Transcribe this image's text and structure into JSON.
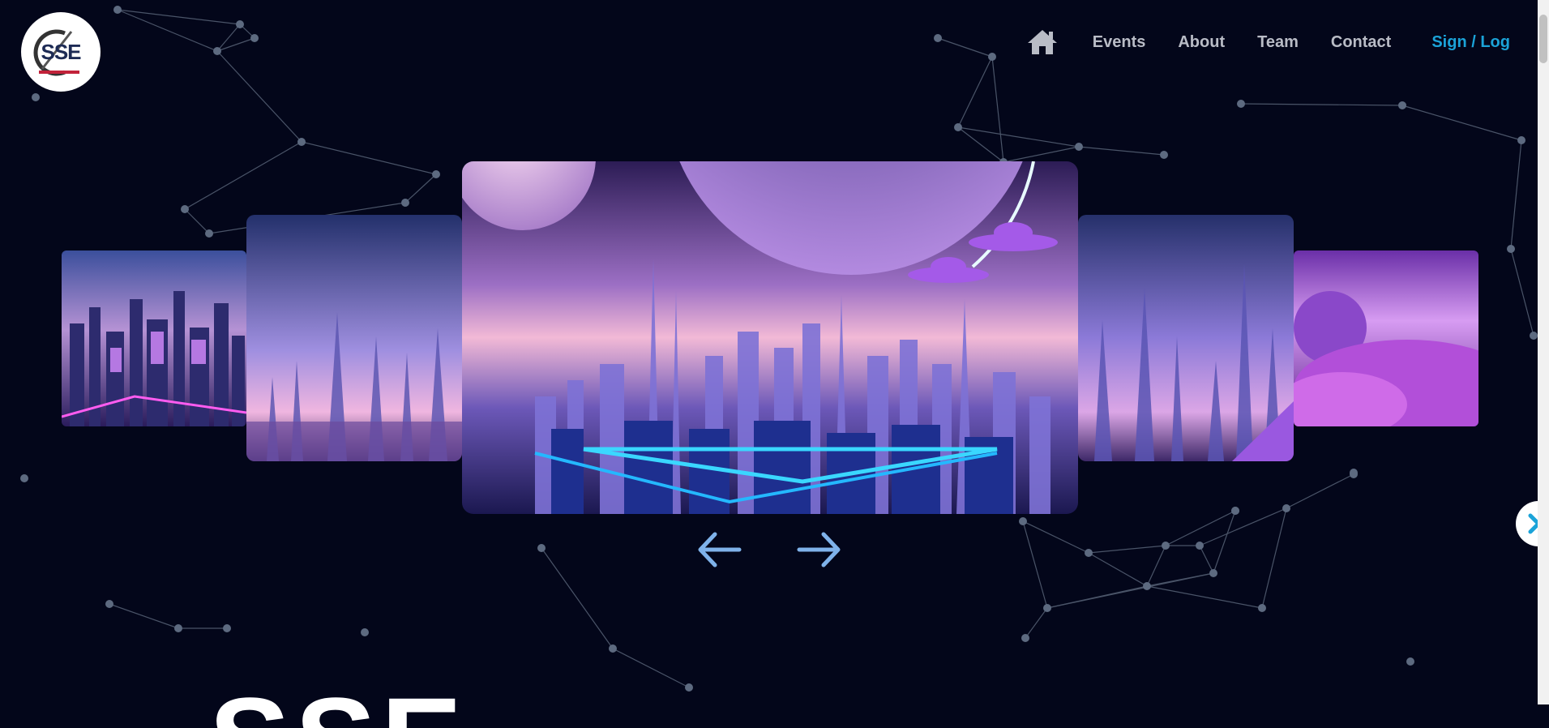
{
  "logo": {
    "text": "SSE",
    "icon": "club-logo"
  },
  "nav": {
    "home_icon": "home-icon",
    "items": [
      "Events",
      "About",
      "Team",
      "Contact"
    ],
    "sign": "Sign / Log"
  },
  "carousel": {
    "prev_icon": "arrow-left-icon",
    "next_icon": "arrow-right-icon",
    "slides": [
      {
        "theme": "neon-city-aerial"
      },
      {
        "theme": "crystal-spire-city"
      },
      {
        "theme": "planet-city-ufo"
      },
      {
        "theme": "violet-towers"
      },
      {
        "theme": "purple-planet-forest"
      }
    ]
  },
  "side_button_icon": "chevron-right-icon",
  "hero_text": "SSE",
  "colors": {
    "background": "#03061a",
    "accent": "#1ba3d8",
    "nav_text": "#b9bcc6",
    "arrow": "#7fb2ea"
  }
}
